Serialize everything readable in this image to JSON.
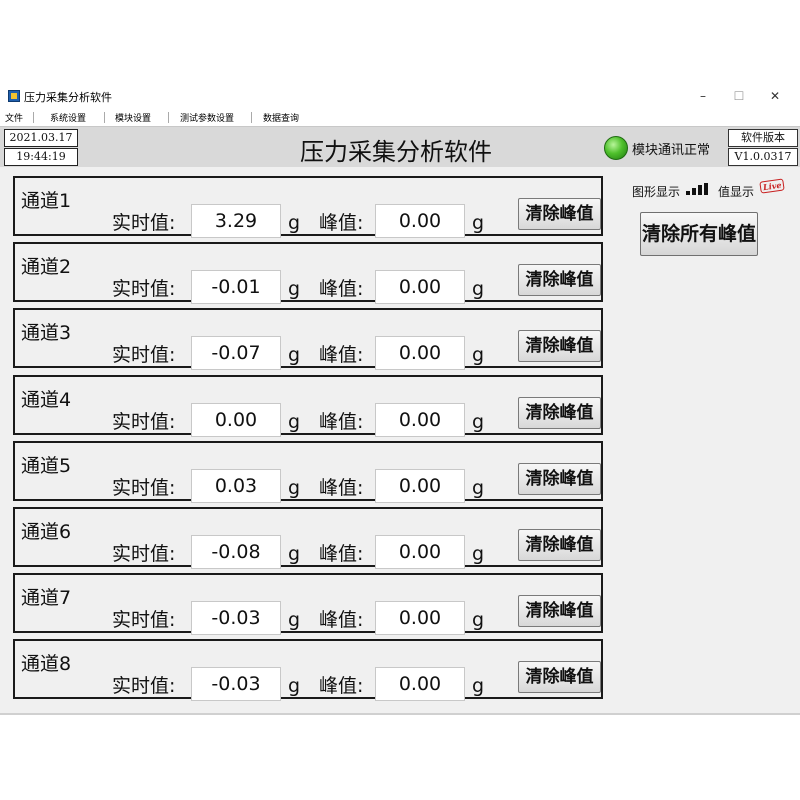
{
  "window": {
    "title": "压力采集分析软件",
    "controls": {
      "minimize": "–",
      "maximize": "☐",
      "close": "✕"
    }
  },
  "menu": [
    "文件",
    "系统设置",
    "模块设置",
    "测试参数设置",
    "数据查询"
  ],
  "header": {
    "date": "2021.03.17",
    "time": "19:44:19",
    "title": "压力采集分析软件",
    "status": "模块通讯正常",
    "status_color": "#3fae22",
    "version_label": "软件版本",
    "version": "V1.0.0317"
  },
  "labels": {
    "realtime": "实时值:",
    "peak": "峰值:",
    "unit": "g",
    "clear_peak": "清除峰值"
  },
  "channels": [
    {
      "name": "通道1",
      "realtime": "3.29",
      "peak": "0.00"
    },
    {
      "name": "通道2",
      "realtime": "-0.01",
      "peak": "0.00"
    },
    {
      "name": "通道3",
      "realtime": "-0.07",
      "peak": "0.00"
    },
    {
      "name": "通道4",
      "realtime": "0.00",
      "peak": "0.00"
    },
    {
      "name": "通道5",
      "realtime": "0.03",
      "peak": "0.00"
    },
    {
      "name": "通道6",
      "realtime": "-0.08",
      "peak": "0.00"
    },
    {
      "name": "通道7",
      "realtime": "-0.03",
      "peak": "0.00"
    },
    {
      "name": "通道8",
      "realtime": "-0.03",
      "peak": "0.00"
    }
  ],
  "side": {
    "graph_display": "图形显示",
    "graph_icon": "signal-bars-icon",
    "value_display": "值显示",
    "live_badge": "Live",
    "clear_all": "清除所有峰值"
  }
}
